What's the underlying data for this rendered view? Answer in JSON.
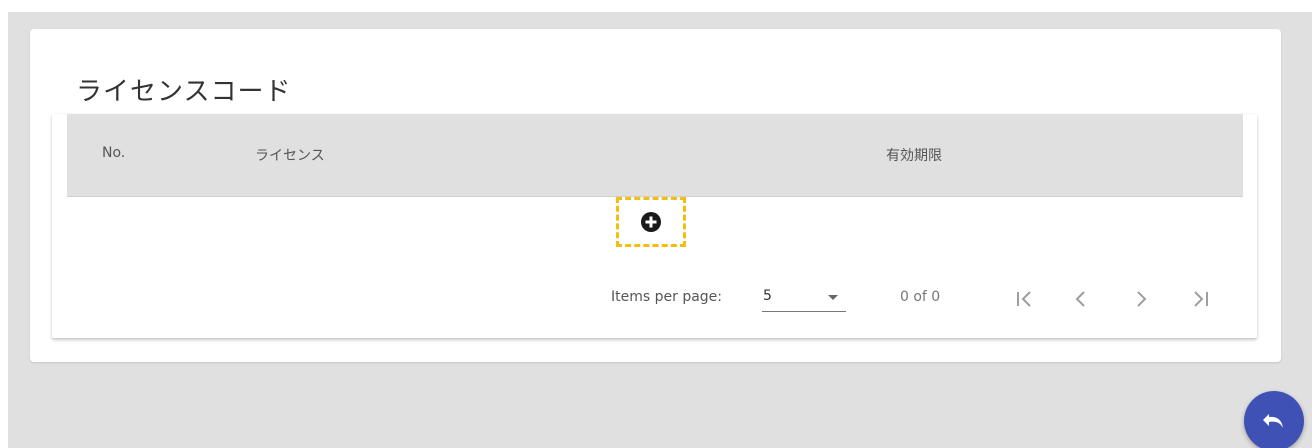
{
  "card": {
    "title": "ライセンスコード"
  },
  "table": {
    "columns": [
      "No.",
      "ライセンス",
      "有効期限"
    ],
    "rows": []
  },
  "paginator": {
    "items_per_page_label": "Items per page:",
    "page_size": "5",
    "range_label": "0 of 0"
  },
  "colors": {
    "background": "#e0e0e0",
    "header_bg": "#e0e0e0",
    "highlight": "#f5bd0c",
    "fab": "#3f51b5"
  },
  "icons": {
    "add": "add-circle-icon",
    "page_size_dropdown": "chevron-down-icon",
    "first": "first-page-icon",
    "previous": "chevron-left-icon",
    "next": "chevron-right-icon",
    "last": "last-page-icon",
    "fab": "undo-icon"
  }
}
